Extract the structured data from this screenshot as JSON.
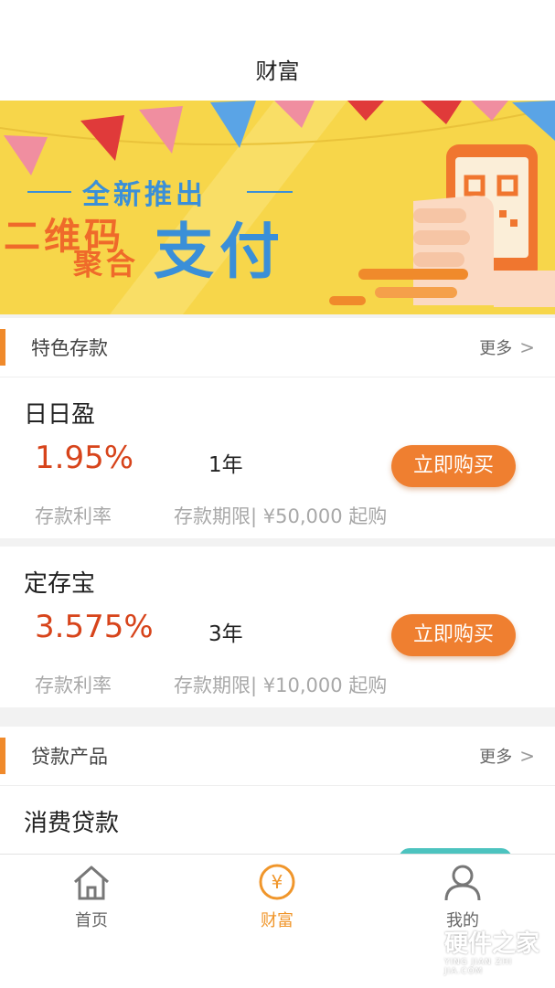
{
  "header": {
    "title": "财富"
  },
  "banner": {
    "line_top": "全新推出",
    "line_left_top": "二维码",
    "line_left_bottom": "聚合",
    "line_big": "支付"
  },
  "deposit_section": {
    "title": "特色存款",
    "more": "更多"
  },
  "deposits": [
    {
      "name": "日日盈",
      "rate": "1.95%",
      "term": "1年",
      "button": "立即购买",
      "rate_label": "存款利率",
      "term_label": "存款期限| ¥50,000 起购"
    },
    {
      "name": "定存宝",
      "rate": "3.575%",
      "term": "3年",
      "button": "立即购买",
      "rate_label": "存款利率",
      "term_label": "存款期限| ¥10,000 起购"
    }
  ],
  "loan_section": {
    "title": "贷款产品",
    "more": "更多"
  },
  "loans": [
    {
      "name": "消费贷款"
    }
  ],
  "tabbar": {
    "items": [
      {
        "label": "首页",
        "icon": "home-icon",
        "active": false
      },
      {
        "label": "财富",
        "icon": "yen-circle-icon",
        "active": true
      },
      {
        "label": "我的",
        "icon": "user-icon",
        "active": false
      }
    ],
    "active_color": "#f0962b",
    "inactive_color": "#666666"
  },
  "watermark": {
    "brand": "硬件之家",
    "sub": "YING JIAN ZHI JIA.COM"
  },
  "colors": {
    "accent": "#ef7f30",
    "rate": "#d7441b",
    "banner_bg": "#f7d64a",
    "banner_blue": "#3a8fd8"
  }
}
